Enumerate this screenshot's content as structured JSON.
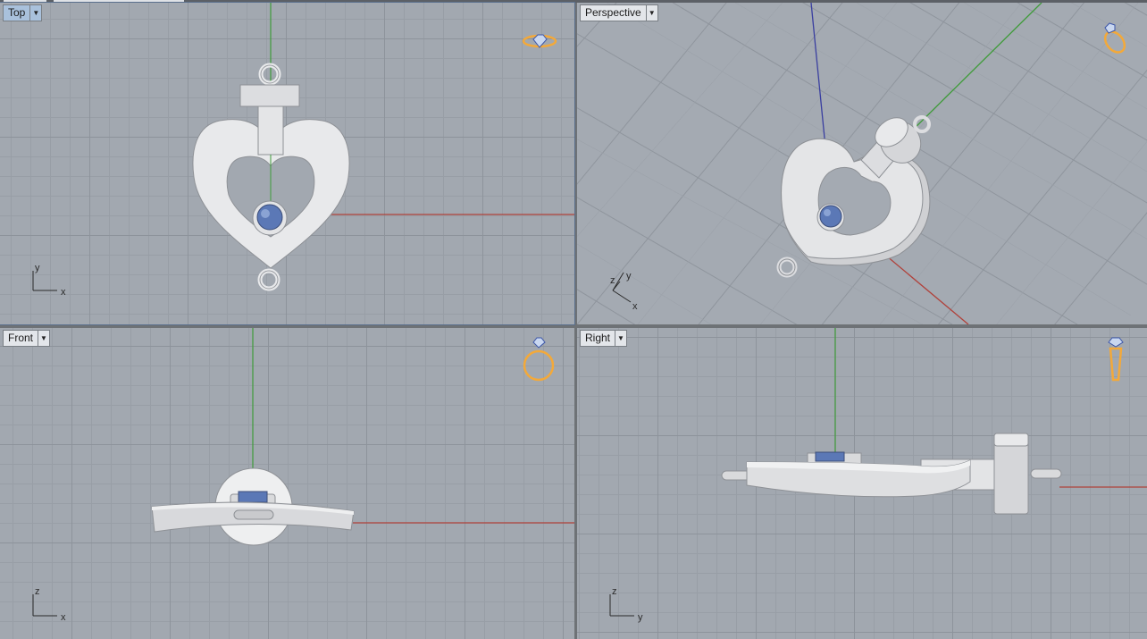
{
  "viewports": {
    "top": {
      "label": "Top",
      "active": true,
      "axis": {
        "v": "y",
        "h": "x"
      }
    },
    "perspective": {
      "label": "Perspective",
      "axis": {
        "z": "z",
        "y": "y",
        "x": "x"
      }
    },
    "front": {
      "label": "Front",
      "axis": {
        "v": "z",
        "h": "x"
      }
    },
    "right": {
      "label": "Right",
      "axis": {
        "v": "z",
        "h": "y"
      }
    }
  },
  "icons": {
    "top_gizmo": "ring-top-view-icon",
    "perspective_gizmo": "ring-perspective-view-icon",
    "front_gizmo": "ring-front-view-icon",
    "right_gizmo": "ring-side-view-icon",
    "dropdown": "chevron-down-icon"
  },
  "colors": {
    "viewport_bg": "#a2a8b0",
    "grid_major": "#8d939b",
    "x_axis": "#b0413a",
    "y_axis": "#3f9b3a",
    "z_axis": "#3a3fa0",
    "metal": "#e6e7e9",
    "gem": "#5b78b6",
    "gizmo": "#f3a93a",
    "active_tab": "#a9c1dc"
  }
}
